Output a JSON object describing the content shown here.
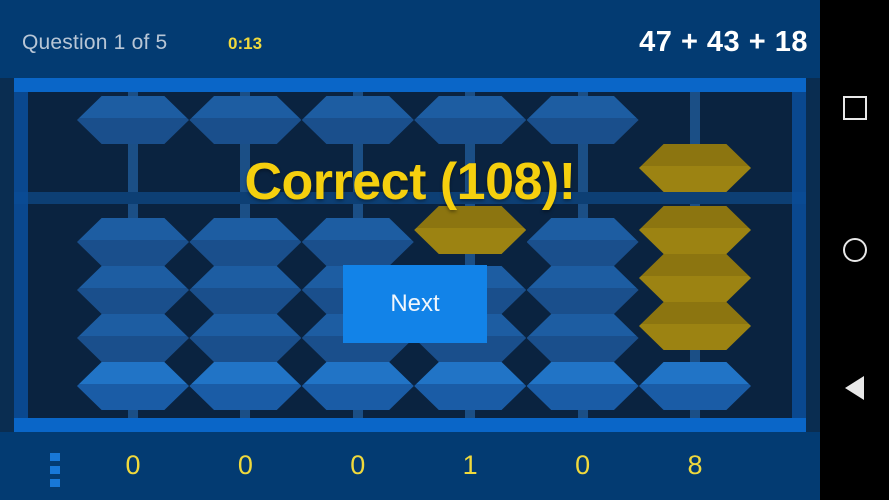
{
  "header": {
    "question_label": "Question 1 of 5",
    "timer": "0:13",
    "equation": "47 + 43 + 18"
  },
  "overlay": {
    "verdict": "Correct (108)!",
    "next_label": "Next"
  },
  "footer": {
    "menu_icon": "vertical-dots-icon",
    "digits": [
      "0",
      "0",
      "0",
      "1",
      "0",
      "8"
    ]
  },
  "abacus": {
    "columns": 6,
    "upper_beads_per_rod": 1,
    "lower_beads_per_rod": 4,
    "values": [
      0,
      0,
      0,
      1,
      0,
      8
    ],
    "colors": {
      "frame": "#0a66c8",
      "board": "#0a2340",
      "bead_blue": "#1d5da2",
      "bead_gold": "#9c8312",
      "rod": "#1b4f86"
    }
  },
  "navbar": {
    "recents": "square-icon",
    "home": "circle-icon",
    "back": "triangle-left-icon"
  }
}
